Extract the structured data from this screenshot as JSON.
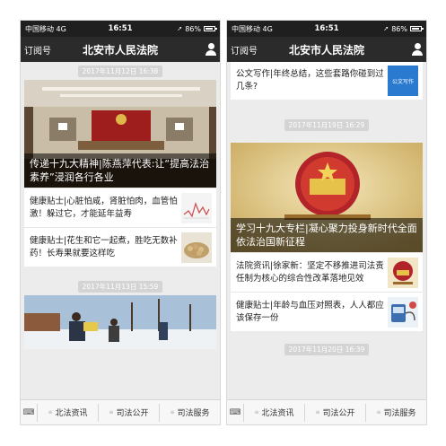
{
  "left": {
    "status": {
      "carrier": "中国移动  4G",
      "time": "16:51",
      "battery": "86%"
    },
    "nav": {
      "back": "订阅号",
      "title": "北安市人民法院"
    },
    "feed": [
      {
        "timestamp": "2017年11月12日 16:38",
        "hero": "传递十九大精神|陈燕萍代表:让“提高法治素养”浸润各行各业",
        "items": [
          "健康贴士|心脏怕咸，肾脏怕肉，血管怕激！躲过它，才能延年益寿",
          "健康贴士|花生和它一起煮，胜吃无数补药！长寿果就要这样吃"
        ]
      },
      {
        "timestamp": "2017年11月13日 15:59"
      }
    ],
    "tabs": [
      "北法资讯",
      "司法公开",
      "司法服务"
    ]
  },
  "right": {
    "status": {
      "carrier": "中国移动  4G",
      "time": "16:51",
      "battery": "86%"
    },
    "nav": {
      "back": "订阅号",
      "title": "北安市人民法院"
    },
    "top_item": "公文写作|年终总结，这些套路你碰到过几条?",
    "top_thumb": "公文写作",
    "feed": [
      {
        "timestamp": "2017年11月19日 16:29",
        "hero": "学习十九大专栏|凝心聚力投身新时代全面依法治国新征程",
        "items": [
          "法院资讯|徐家新：坚定不移推进司法责任制为核心的综合性改革落地见效",
          "健康贴士|年龄与血压对照表，人人都应该保存一份"
        ]
      },
      {
        "timestamp": "2017年11月20日 16:39"
      }
    ],
    "tabs": [
      "北法资讯",
      "司法公开",
      "司法服务"
    ]
  }
}
